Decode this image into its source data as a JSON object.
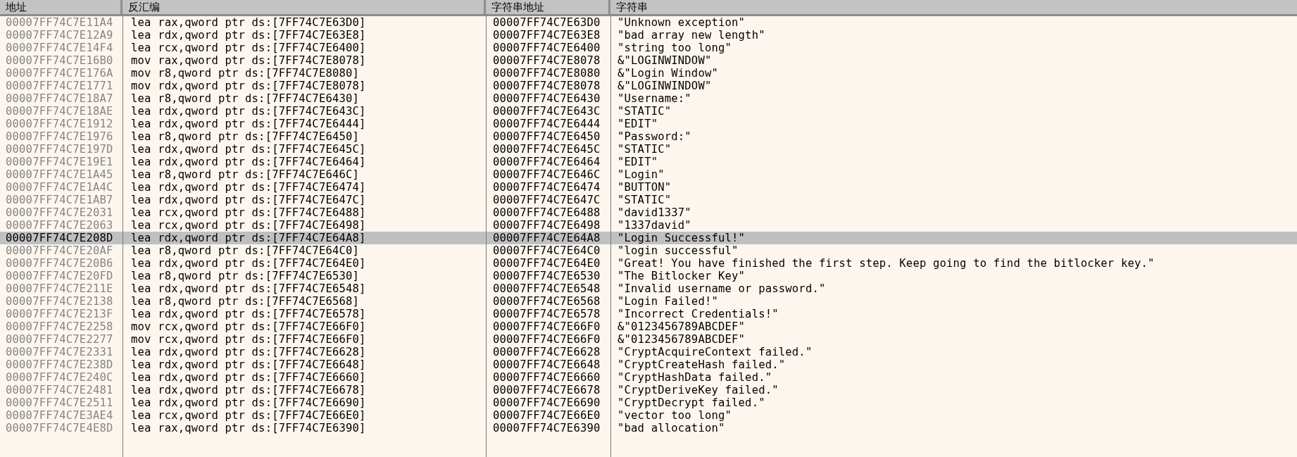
{
  "columns": [
    "地址",
    "反汇编",
    "字符串地址",
    "字符串"
  ],
  "rows": [
    {
      "address": "00007FF74C7E11A4",
      "disassembly": "lea rax,qword ptr ds:[7FF74C7E63D0]",
      "string_address": "00007FF74C7E63D0",
      "string": "\"Unknown exception\"",
      "selected": false
    },
    {
      "address": "00007FF74C7E12A9",
      "disassembly": "lea rdx,qword ptr ds:[7FF74C7E63E8]",
      "string_address": "00007FF74C7E63E8",
      "string": "\"bad array new length\"",
      "selected": false
    },
    {
      "address": "00007FF74C7E14F4",
      "disassembly": "lea rcx,qword ptr ds:[7FF74C7E6400]",
      "string_address": "00007FF74C7E6400",
      "string": "\"string too long\"",
      "selected": false
    },
    {
      "address": "00007FF74C7E16B0",
      "disassembly": "mov rax,qword ptr ds:[7FF74C7E8078]",
      "string_address": "00007FF74C7E8078",
      "string": "&\"LOGINWINDOW\"",
      "selected": false
    },
    {
      "address": "00007FF74C7E176A",
      "disassembly": "mov r8,qword ptr ds:[7FF74C7E8080]",
      "string_address": "00007FF74C7E8080",
      "string": "&\"Login Window\"",
      "selected": false
    },
    {
      "address": "00007FF74C7E1771",
      "disassembly": "mov rdx,qword ptr ds:[7FF74C7E8078]",
      "string_address": "00007FF74C7E8078",
      "string": "&\"LOGINWINDOW\"",
      "selected": false
    },
    {
      "address": "00007FF74C7E18A7",
      "disassembly": "lea r8,qword ptr ds:[7FF74C7E6430]",
      "string_address": "00007FF74C7E6430",
      "string": "\"Username:\"",
      "selected": false
    },
    {
      "address": "00007FF74C7E18AE",
      "disassembly": "lea rdx,qword ptr ds:[7FF74C7E643C]",
      "string_address": "00007FF74C7E643C",
      "string": "\"STATIC\"",
      "selected": false
    },
    {
      "address": "00007FF74C7E1912",
      "disassembly": "lea rdx,qword ptr ds:[7FF74C7E6444]",
      "string_address": "00007FF74C7E6444",
      "string": "\"EDIT\"",
      "selected": false
    },
    {
      "address": "00007FF74C7E1976",
      "disassembly": "lea r8,qword ptr ds:[7FF74C7E6450]",
      "string_address": "00007FF74C7E6450",
      "string": "\"Password:\"",
      "selected": false
    },
    {
      "address": "00007FF74C7E197D",
      "disassembly": "lea rdx,qword ptr ds:[7FF74C7E645C]",
      "string_address": "00007FF74C7E645C",
      "string": "\"STATIC\"",
      "selected": false
    },
    {
      "address": "00007FF74C7E19E1",
      "disassembly": "lea rdx,qword ptr ds:[7FF74C7E6464]",
      "string_address": "00007FF74C7E6464",
      "string": "\"EDIT\"",
      "selected": false
    },
    {
      "address": "00007FF74C7E1A45",
      "disassembly": "lea r8,qword ptr ds:[7FF74C7E646C]",
      "string_address": "00007FF74C7E646C",
      "string": "\"Login\"",
      "selected": false
    },
    {
      "address": "00007FF74C7E1A4C",
      "disassembly": "lea rdx,qword ptr ds:[7FF74C7E6474]",
      "string_address": "00007FF74C7E6474",
      "string": "\"BUTTON\"",
      "selected": false
    },
    {
      "address": "00007FF74C7E1AB7",
      "disassembly": "lea rdx,qword ptr ds:[7FF74C7E647C]",
      "string_address": "00007FF74C7E647C",
      "string": "\"STATIC\"",
      "selected": false
    },
    {
      "address": "00007FF74C7E2031",
      "disassembly": "lea rcx,qword ptr ds:[7FF74C7E6488]",
      "string_address": "00007FF74C7E6488",
      "string": "\"david1337\"",
      "selected": false
    },
    {
      "address": "00007FF74C7E2063",
      "disassembly": "lea rcx,qword ptr ds:[7FF74C7E6498]",
      "string_address": "00007FF74C7E6498",
      "string": "\"1337david\"",
      "selected": false
    },
    {
      "address": "00007FF74C7E208D",
      "disassembly": "lea rdx,qword ptr ds:[7FF74C7E64A8]",
      "string_address": "00007FF74C7E64A8",
      "string": "\"Login Successful!\"",
      "selected": true
    },
    {
      "address": "00007FF74C7E20AF",
      "disassembly": "lea r8,qword ptr ds:[7FF74C7E64C0]",
      "string_address": "00007FF74C7E64C0",
      "string": "\"login successful\"",
      "selected": false
    },
    {
      "address": "00007FF74C7E20B6",
      "disassembly": "lea rdx,qword ptr ds:[7FF74C7E64E0]",
      "string_address": "00007FF74C7E64E0",
      "string": "\"Great! You have finished the first step. Keep going to find the bitlocker key.\"",
      "selected": false
    },
    {
      "address": "00007FF74C7E20FD",
      "disassembly": "lea r8,qword ptr ds:[7FF74C7E6530]",
      "string_address": "00007FF74C7E6530",
      "string": "\"The Bitlocker Key\"",
      "selected": false
    },
    {
      "address": "00007FF74C7E211E",
      "disassembly": "lea rdx,qword ptr ds:[7FF74C7E6548]",
      "string_address": "00007FF74C7E6548",
      "string": "\"Invalid username or password.\"",
      "selected": false
    },
    {
      "address": "00007FF74C7E2138",
      "disassembly": "lea r8,qword ptr ds:[7FF74C7E6568]",
      "string_address": "00007FF74C7E6568",
      "string": "\"Login Failed!\"",
      "selected": false
    },
    {
      "address": "00007FF74C7E213F",
      "disassembly": "lea rdx,qword ptr ds:[7FF74C7E6578]",
      "string_address": "00007FF74C7E6578",
      "string": "\"Incorrect Credentials!\"",
      "selected": false
    },
    {
      "address": "00007FF74C7E2258",
      "disassembly": "mov rcx,qword ptr ds:[7FF74C7E66F0]",
      "string_address": "00007FF74C7E66F0",
      "string": "&\"0123456789ABCDEF\"",
      "selected": false
    },
    {
      "address": "00007FF74C7E2277",
      "disassembly": "mov rcx,qword ptr ds:[7FF74C7E66F0]",
      "string_address": "00007FF74C7E66F0",
      "string": "&\"0123456789ABCDEF\"",
      "selected": false
    },
    {
      "address": "00007FF74C7E2331",
      "disassembly": "lea rdx,qword ptr ds:[7FF74C7E6628]",
      "string_address": "00007FF74C7E6628",
      "string": "\"CryptAcquireContext failed.\"",
      "selected": false
    },
    {
      "address": "00007FF74C7E238D",
      "disassembly": "lea rdx,qword ptr ds:[7FF74C7E6648]",
      "string_address": "00007FF74C7E6648",
      "string": "\"CryptCreateHash failed.\"",
      "selected": false
    },
    {
      "address": "00007FF74C7E240C",
      "disassembly": "lea rdx,qword ptr ds:[7FF74C7E6660]",
      "string_address": "00007FF74C7E6660",
      "string": "\"CryptHashData failed.\"",
      "selected": false
    },
    {
      "address": "00007FF74C7E2481",
      "disassembly": "lea rdx,qword ptr ds:[7FF74C7E6678]",
      "string_address": "00007FF74C7E6678",
      "string": "\"CryptDeriveKey failed.\"",
      "selected": false
    },
    {
      "address": "00007FF74C7E2511",
      "disassembly": "lea rdx,qword ptr ds:[7FF74C7E6690]",
      "string_address": "00007FF74C7E6690",
      "string": "\"CryptDecrypt failed.\"",
      "selected": false
    },
    {
      "address": "00007FF74C7E3AE4",
      "disassembly": "lea rcx,qword ptr ds:[7FF74C7E66E0]",
      "string_address": "00007FF74C7E66E0",
      "string": "\"vector too long\"",
      "selected": false
    },
    {
      "address": "00007FF74C7E4E8D",
      "disassembly": "lea rax,qword ptr ds:[7FF74C7E6390]",
      "string_address": "00007FF74C7E6390",
      "string": "\"bad allocation\"",
      "selected": false
    }
  ]
}
